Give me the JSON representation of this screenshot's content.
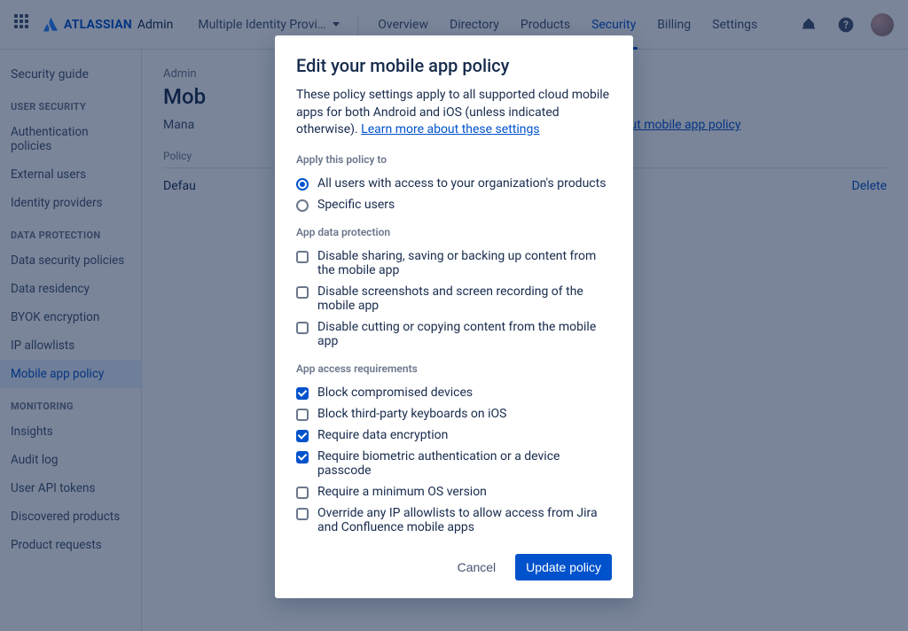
{
  "topnav": {
    "brand_prefix": "ATLASSIAN",
    "brand_suffix": "Admin",
    "org_name": "Multiple Identity Provi…",
    "links": [
      "Overview",
      "Directory",
      "Products",
      "Security",
      "Billing",
      "Settings"
    ],
    "active_index": 3
  },
  "sidebar": {
    "top_link": "Security guide",
    "groups": [
      {
        "heading": "USER SECURITY",
        "items": [
          "Authentication policies",
          "External users",
          "Identity providers"
        ]
      },
      {
        "heading": "DATA PROTECTION",
        "items": [
          "Data security policies",
          "Data residency",
          "BYOK encryption",
          "IP allowlists",
          "Mobile app policy"
        ]
      },
      {
        "heading": "MONITORING",
        "items": [
          "Insights",
          "Audit log",
          "User API tokens",
          "Discovered products",
          "Product requests"
        ]
      }
    ],
    "active": "Mobile app policy"
  },
  "page": {
    "breadcrumb": "Admin",
    "title": "Mob",
    "desc_prefix": "Mana",
    "desc_link": "Learn more about mobile app policy",
    "policy_label": "Policy",
    "policy_name": "Defau",
    "delete": "Delete"
  },
  "modal": {
    "title": "Edit your mobile app policy",
    "desc": "These policy settings apply to all supported cloud mobile apps for both Android and iOS (unless indicated otherwise). ",
    "desc_link": "Learn more about these settings",
    "sec_apply": "Apply this policy to",
    "radios": [
      {
        "label": "All users with access to your organization's products",
        "checked": true
      },
      {
        "label": "Specific users",
        "checked": false
      }
    ],
    "sec_data": "App data protection",
    "data_checks": [
      {
        "label": "Disable sharing, saving or backing up content from the mobile app",
        "checked": false
      },
      {
        "label": "Disable screenshots and screen recording of the mobile app",
        "checked": false
      },
      {
        "label": "Disable cutting or copying content from the mobile app",
        "checked": false
      }
    ],
    "sec_access": "App access requirements",
    "access_checks": [
      {
        "label": "Block compromised devices",
        "checked": true
      },
      {
        "label": "Block third-party keyboards on iOS",
        "checked": false
      },
      {
        "label": "Require data encryption",
        "checked": true
      },
      {
        "label": "Require biometric authentication or a device passcode",
        "checked": true
      },
      {
        "label": "Require a minimum OS version",
        "checked": false
      },
      {
        "label": "Override any IP allowlists to allow access from Jira and Confluence mobile apps",
        "checked": false
      }
    ],
    "cancel": "Cancel",
    "submit": "Update policy"
  }
}
